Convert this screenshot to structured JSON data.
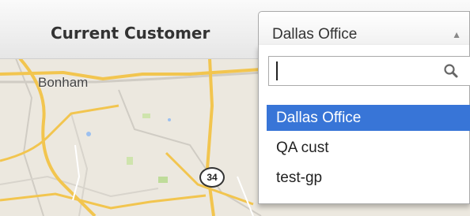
{
  "header": {
    "label": "Current Customer"
  },
  "customer_select": {
    "selected_value": "Dallas Office",
    "arrow_icon": "arrow-up-icon",
    "search_value": "",
    "search_icon": "search-icon",
    "options": [
      {
        "label": "Dallas Office",
        "selected": true
      },
      {
        "label": "QA cust",
        "selected": false
      },
      {
        "label": "test-gp",
        "selected": false
      }
    ],
    "highlight_color": "#3875d7"
  },
  "map": {
    "place_label": "Bonham",
    "route_shield": "34",
    "road_color": "#f2c54f",
    "background_color": "#ece8df"
  }
}
